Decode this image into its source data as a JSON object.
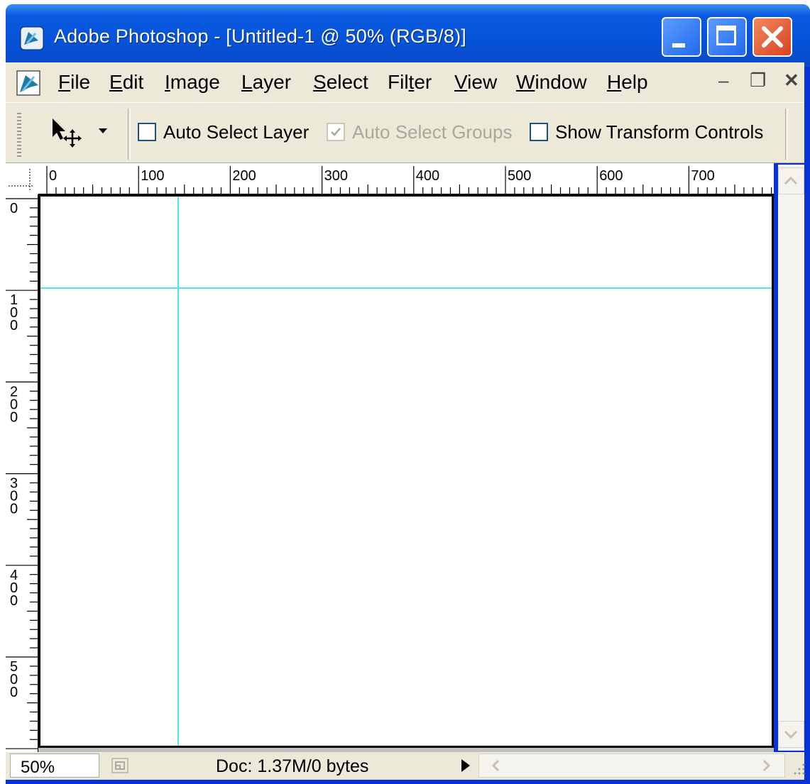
{
  "window": {
    "title": "Adobe Photoshop - [Untitled-1 @ 50% (RGB/8)]"
  },
  "menu": {
    "items": [
      {
        "pre": "",
        "key": "F",
        "post": "ile"
      },
      {
        "pre": "",
        "key": "E",
        "post": "dit"
      },
      {
        "pre": "",
        "key": "I",
        "post": "mage"
      },
      {
        "pre": "",
        "key": "L",
        "post": "ayer"
      },
      {
        "pre": "",
        "key": "S",
        "post": "elect"
      },
      {
        "pre": "Fil",
        "key": "t",
        "post": "er"
      },
      {
        "pre": "",
        "key": "V",
        "post": "iew"
      },
      {
        "pre": "",
        "key": "W",
        "post": "indow"
      },
      {
        "pre": "",
        "key": "H",
        "post": "elp"
      }
    ]
  },
  "options": {
    "auto_select_layer": {
      "label": "Auto Select Layer",
      "checked": false,
      "enabled": true
    },
    "auto_select_groups": {
      "label": "Auto Select Groups",
      "checked": true,
      "enabled": false
    },
    "show_transform_controls": {
      "label": "Show Transform Controls",
      "checked": false,
      "enabled": true
    }
  },
  "rulers": {
    "horizontal_labels": [
      "0",
      "100",
      "200",
      "300",
      "400",
      "500",
      "600",
      "700"
    ],
    "vertical_labels": [
      "0",
      "100",
      "200",
      "300",
      "400",
      "500"
    ]
  },
  "status": {
    "zoom": "50%",
    "doc_info": "Doc: 1.37M/0 bytes"
  },
  "colors": {
    "titlebar": "#0453d8",
    "chrome": "#ece9d8",
    "guide": "#4de4ec",
    "canvas": "#ffffff"
  }
}
